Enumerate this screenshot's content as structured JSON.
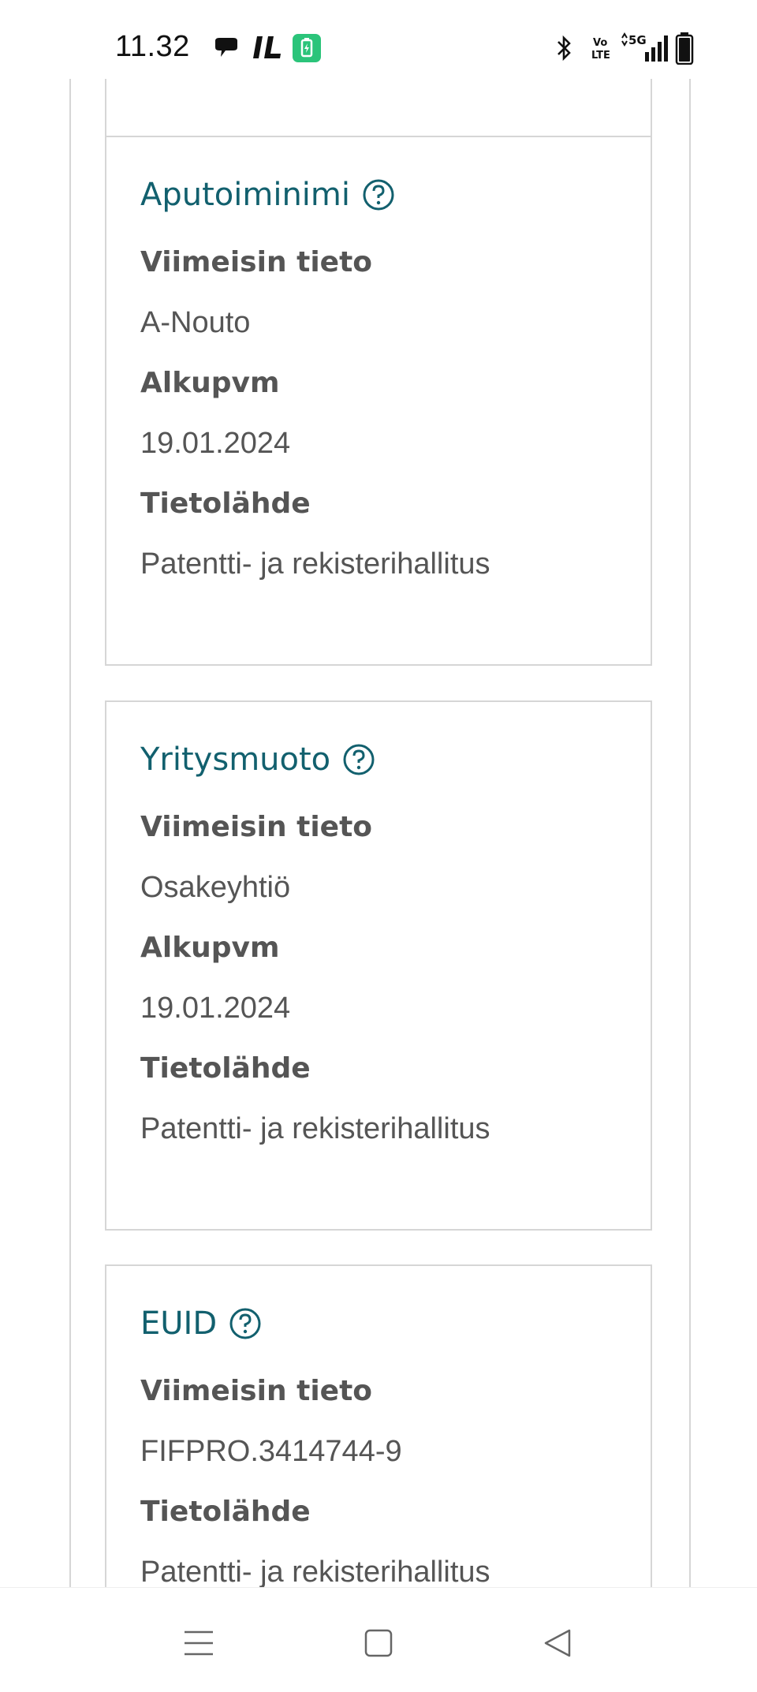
{
  "status_bar": {
    "time": "11.32",
    "left_icons": [
      "chat-bubble-icon",
      "il-app-icon",
      "battery-saver-icon"
    ],
    "right_icons": [
      "bluetooth-icon",
      "volte-icon",
      "5g-signal-icon",
      "battery-icon"
    ],
    "network_label": "5G",
    "volte_label": "Vo LTE"
  },
  "cards": [
    {
      "title": "Aputoiminimi",
      "fields": [
        {
          "label": "Viimeisin tieto",
          "value": "A-Nouto"
        },
        {
          "label": "Alkupvm",
          "value": "19.01.2024"
        },
        {
          "label": "Tietolähde",
          "value": "Patentti- ja rekisterihallitus"
        }
      ]
    },
    {
      "title": "Yritysmuoto",
      "fields": [
        {
          "label": "Viimeisin tieto",
          "value": "Osakeyhtiö"
        },
        {
          "label": "Alkupvm",
          "value": "19.01.2024"
        },
        {
          "label": "Tietolähde",
          "value": "Patentti- ja rekisterihallitus"
        }
      ]
    },
    {
      "title": "EUID",
      "fields": [
        {
          "label": "Viimeisin tieto",
          "value": "FIFPRO.3414744-9"
        },
        {
          "label": "Tietolähde",
          "value": "Patentti- ja rekisterihallitus"
        }
      ]
    }
  ],
  "nav_bar": {
    "buttons": [
      "menu-icon",
      "home-icon",
      "back-icon"
    ]
  },
  "colors": {
    "title": "#12606e",
    "text": "#555555",
    "border": "#d6d6d6"
  }
}
